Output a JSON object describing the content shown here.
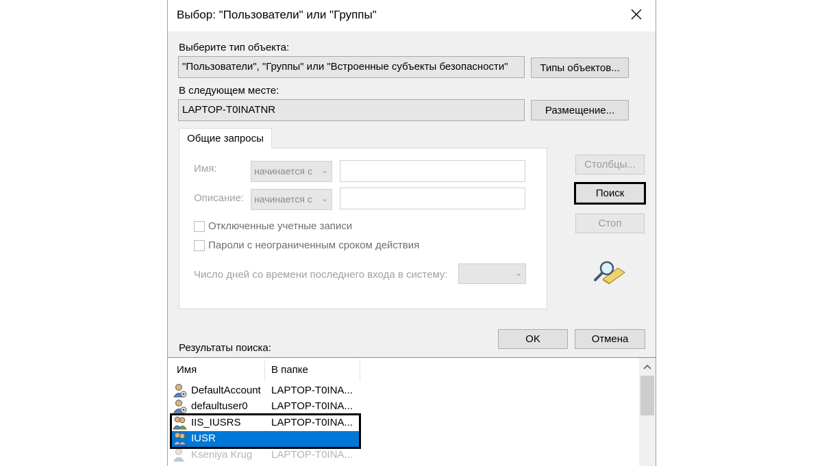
{
  "window": {
    "title": "Выбор: \"Пользователи\" или \"Группы\""
  },
  "object_type": {
    "label": "Выберите тип объекта:",
    "value": "\"Пользователи\", \"Группы\" или \"Встроенные субъекты безопасности\"",
    "button": "Типы объектов..."
  },
  "location": {
    "label": "В следующем месте:",
    "value": "LAPTOP-T0INATNR",
    "button": "Размещение..."
  },
  "query_tab": {
    "label": "Общие запросы",
    "name_label": "Имя:",
    "name_mode": "начинается с",
    "desc_label": "Описание:",
    "desc_mode": "начинается с",
    "disabled_accounts": "Отключенные учетные записи",
    "no_expire_passwords": "Пароли с неограниченным сроком действия",
    "days_label": "Число дней со времени последнего входа в систему:"
  },
  "side_buttons": {
    "columns": "Столбцы...",
    "search": "Поиск",
    "stop": "Стоп"
  },
  "icons": {
    "close": "close-icon",
    "search_animation": "magnifier-search-icon",
    "user": "user-icon",
    "group": "group-icon"
  },
  "dialog_buttons": {
    "ok": "OK",
    "cancel": "Отмена"
  },
  "results": {
    "label": "Результаты поиска:",
    "columns": [
      "Имя",
      "В папке"
    ],
    "rows": [
      {
        "name": "DefaultAccount",
        "folder": "LAPTOP-T0INA...",
        "icon": "user-icon",
        "selected": false
      },
      {
        "name": "defaultuser0",
        "folder": "LAPTOP-T0INA...",
        "icon": "user-icon",
        "selected": false
      },
      {
        "name": "IIS_IUSRS",
        "folder": "LAPTOP-T0INA...",
        "icon": "group-icon",
        "selected": false
      },
      {
        "name": "IUSR",
        "folder": "",
        "icon": "group-icon",
        "selected": true
      },
      {
        "name": "Kseniya Krug",
        "folder": "LAPTOP-T0INA...",
        "icon": "user-icon",
        "selected": false
      }
    ]
  },
  "colors": {
    "selection": "#0078d7",
    "window_border": "#b18fc2",
    "highlight_box": "#000000"
  }
}
